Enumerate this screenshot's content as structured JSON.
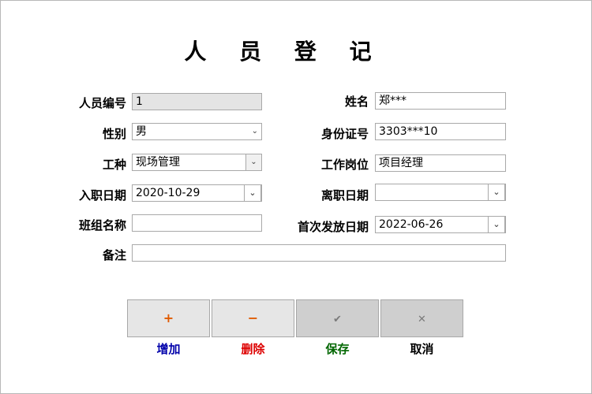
{
  "title": "人 员 登 记",
  "left": {
    "id_label": "人员编号",
    "id_value": "1",
    "gender_label": "性别",
    "gender_value": "男",
    "worktype_label": "工种",
    "worktype_value": "现场管理",
    "hire_label": "入职日期",
    "hire_value": "2020-10-29",
    "team_label": "班组名称",
    "team_value": ""
  },
  "right": {
    "name_label": "姓名",
    "name_value": "郑***",
    "idcard_label": "身份证号",
    "idcard_value": "3303***10",
    "post_label": "工作岗位",
    "post_value": "项目经理",
    "leave_label": "离职日期",
    "leave_value": "",
    "firstpay_label": "首次发放日期",
    "firstpay_value": "2022-06-26"
  },
  "remark_label": "备注",
  "remark_value": "",
  "buttons": {
    "add": {
      "icon": "+",
      "label": "增加",
      "color": "#0000aa",
      "icon_color": "#e05a00"
    },
    "delete": {
      "icon": "−",
      "label": "删除",
      "color": "#dd0000",
      "icon_color": "#e05a00"
    },
    "save": {
      "icon": "✔",
      "label": "保存",
      "color": "#006600",
      "icon_color": "#7a7a7a"
    },
    "cancel": {
      "icon": "✕",
      "label": "取消",
      "color": "#000000",
      "icon_color": "#7a7a7a"
    }
  }
}
